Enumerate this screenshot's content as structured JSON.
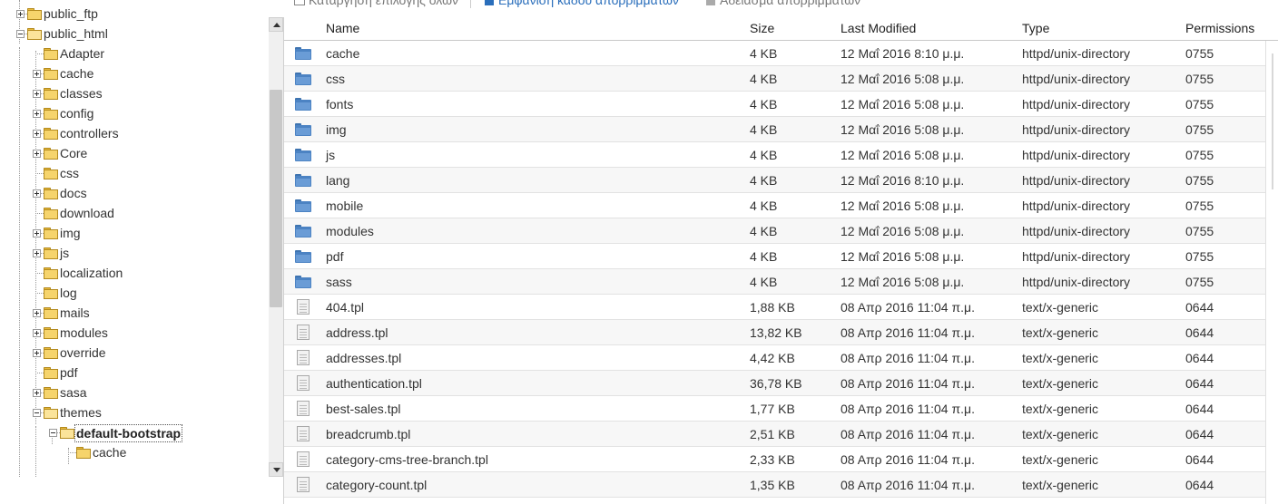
{
  "toolbar": {
    "deselect_all": "Κατάργηση επιλογής όλων",
    "view_trash": "Εμφάνιση κάδου απορριμμάτων",
    "empty_trash": "Άδειασμα απορριμμάτων"
  },
  "tree": {
    "items": [
      {
        "label": "public_ftp",
        "depth": 0,
        "expander": "plus",
        "open": false
      },
      {
        "label": "public_html",
        "depth": 0,
        "expander": "minus",
        "open": true
      },
      {
        "label": "Adapter",
        "depth": 1,
        "expander": "none",
        "open": false
      },
      {
        "label": "cache",
        "depth": 1,
        "expander": "plus",
        "open": false
      },
      {
        "label": "classes",
        "depth": 1,
        "expander": "plus",
        "open": false
      },
      {
        "label": "config",
        "depth": 1,
        "expander": "plus",
        "open": false
      },
      {
        "label": "controllers",
        "depth": 1,
        "expander": "plus",
        "open": false
      },
      {
        "label": "Core",
        "depth": 1,
        "expander": "plus",
        "open": false
      },
      {
        "label": "css",
        "depth": 1,
        "expander": "none",
        "open": false
      },
      {
        "label": "docs",
        "depth": 1,
        "expander": "plus",
        "open": false
      },
      {
        "label": "download",
        "depth": 1,
        "expander": "none",
        "open": false
      },
      {
        "label": "img",
        "depth": 1,
        "expander": "plus",
        "open": false
      },
      {
        "label": "js",
        "depth": 1,
        "expander": "plus",
        "open": false
      },
      {
        "label": "localization",
        "depth": 1,
        "expander": "none",
        "open": false
      },
      {
        "label": "log",
        "depth": 1,
        "expander": "none",
        "open": false
      },
      {
        "label": "mails",
        "depth": 1,
        "expander": "plus",
        "open": false
      },
      {
        "label": "modules",
        "depth": 1,
        "expander": "plus",
        "open": false
      },
      {
        "label": "override",
        "depth": 1,
        "expander": "plus",
        "open": false
      },
      {
        "label": "pdf",
        "depth": 1,
        "expander": "none",
        "open": false
      },
      {
        "label": "sasa",
        "depth": 1,
        "expander": "plus",
        "open": false
      },
      {
        "label": "themes",
        "depth": 1,
        "expander": "minus",
        "open": true
      },
      {
        "label": "default-bootstrap",
        "depth": 2,
        "expander": "minus",
        "open": true,
        "selected": true
      },
      {
        "label": "cache",
        "depth": 3,
        "expander": "none",
        "open": false
      }
    ]
  },
  "table": {
    "columns": [
      "Name",
      "Size",
      "Last Modified",
      "Type",
      "Permissions"
    ],
    "rows": [
      {
        "kind": "dir",
        "name": "cache",
        "size": "4 KB",
        "modified": "12 Μαΐ 2016 8:10 μ.μ.",
        "type": "httpd/unix-directory",
        "perms": "0755"
      },
      {
        "kind": "dir",
        "name": "css",
        "size": "4 KB",
        "modified": "12 Μαΐ 2016 5:08 μ.μ.",
        "type": "httpd/unix-directory",
        "perms": "0755"
      },
      {
        "kind": "dir",
        "name": "fonts",
        "size": "4 KB",
        "modified": "12 Μαΐ 2016 5:08 μ.μ.",
        "type": "httpd/unix-directory",
        "perms": "0755"
      },
      {
        "kind": "dir",
        "name": "img",
        "size": "4 KB",
        "modified": "12 Μαΐ 2016 5:08 μ.μ.",
        "type": "httpd/unix-directory",
        "perms": "0755"
      },
      {
        "kind": "dir",
        "name": "js",
        "size": "4 KB",
        "modified": "12 Μαΐ 2016 5:08 μ.μ.",
        "type": "httpd/unix-directory",
        "perms": "0755"
      },
      {
        "kind": "dir",
        "name": "lang",
        "size": "4 KB",
        "modified": "12 Μαΐ 2016 8:10 μ.μ.",
        "type": "httpd/unix-directory",
        "perms": "0755"
      },
      {
        "kind": "dir",
        "name": "mobile",
        "size": "4 KB",
        "modified": "12 Μαΐ 2016 5:08 μ.μ.",
        "type": "httpd/unix-directory",
        "perms": "0755"
      },
      {
        "kind": "dir",
        "name": "modules",
        "size": "4 KB",
        "modified": "12 Μαΐ 2016 5:08 μ.μ.",
        "type": "httpd/unix-directory",
        "perms": "0755"
      },
      {
        "kind": "dir",
        "name": "pdf",
        "size": "4 KB",
        "modified": "12 Μαΐ 2016 5:08 μ.μ.",
        "type": "httpd/unix-directory",
        "perms": "0755"
      },
      {
        "kind": "dir",
        "name": "sass",
        "size": "4 KB",
        "modified": "12 Μαΐ 2016 5:08 μ.μ.",
        "type": "httpd/unix-directory",
        "perms": "0755"
      },
      {
        "kind": "file",
        "name": "404.tpl",
        "size": "1,88 KB",
        "modified": "08 Απρ 2016 11:04 π.μ.",
        "type": "text/x-generic",
        "perms": "0644"
      },
      {
        "kind": "file",
        "name": "address.tpl",
        "size": "13,82 KB",
        "modified": "08 Απρ 2016 11:04 π.μ.",
        "type": "text/x-generic",
        "perms": "0644"
      },
      {
        "kind": "file",
        "name": "addresses.tpl",
        "size": "4,42 KB",
        "modified": "08 Απρ 2016 11:04 π.μ.",
        "type": "text/x-generic",
        "perms": "0644"
      },
      {
        "kind": "file",
        "name": "authentication.tpl",
        "size": "36,78 KB",
        "modified": "08 Απρ 2016 11:04 π.μ.",
        "type": "text/x-generic",
        "perms": "0644"
      },
      {
        "kind": "file",
        "name": "best-sales.tpl",
        "size": "1,77 KB",
        "modified": "08 Απρ 2016 11:04 π.μ.",
        "type": "text/x-generic",
        "perms": "0644"
      },
      {
        "kind": "file",
        "name": "breadcrumb.tpl",
        "size": "2,51 KB",
        "modified": "08 Απρ 2016 11:04 π.μ.",
        "type": "text/x-generic",
        "perms": "0644"
      },
      {
        "kind": "file",
        "name": "category-cms-tree-branch.tpl",
        "size": "2,33 KB",
        "modified": "08 Απρ 2016 11:04 π.μ.",
        "type": "text/x-generic",
        "perms": "0644"
      },
      {
        "kind": "file",
        "name": "category-count.tpl",
        "size": "1,35 KB",
        "modified": "08 Απρ 2016 11:04 π.μ.",
        "type": "text/x-generic",
        "perms": "0644"
      }
    ]
  }
}
